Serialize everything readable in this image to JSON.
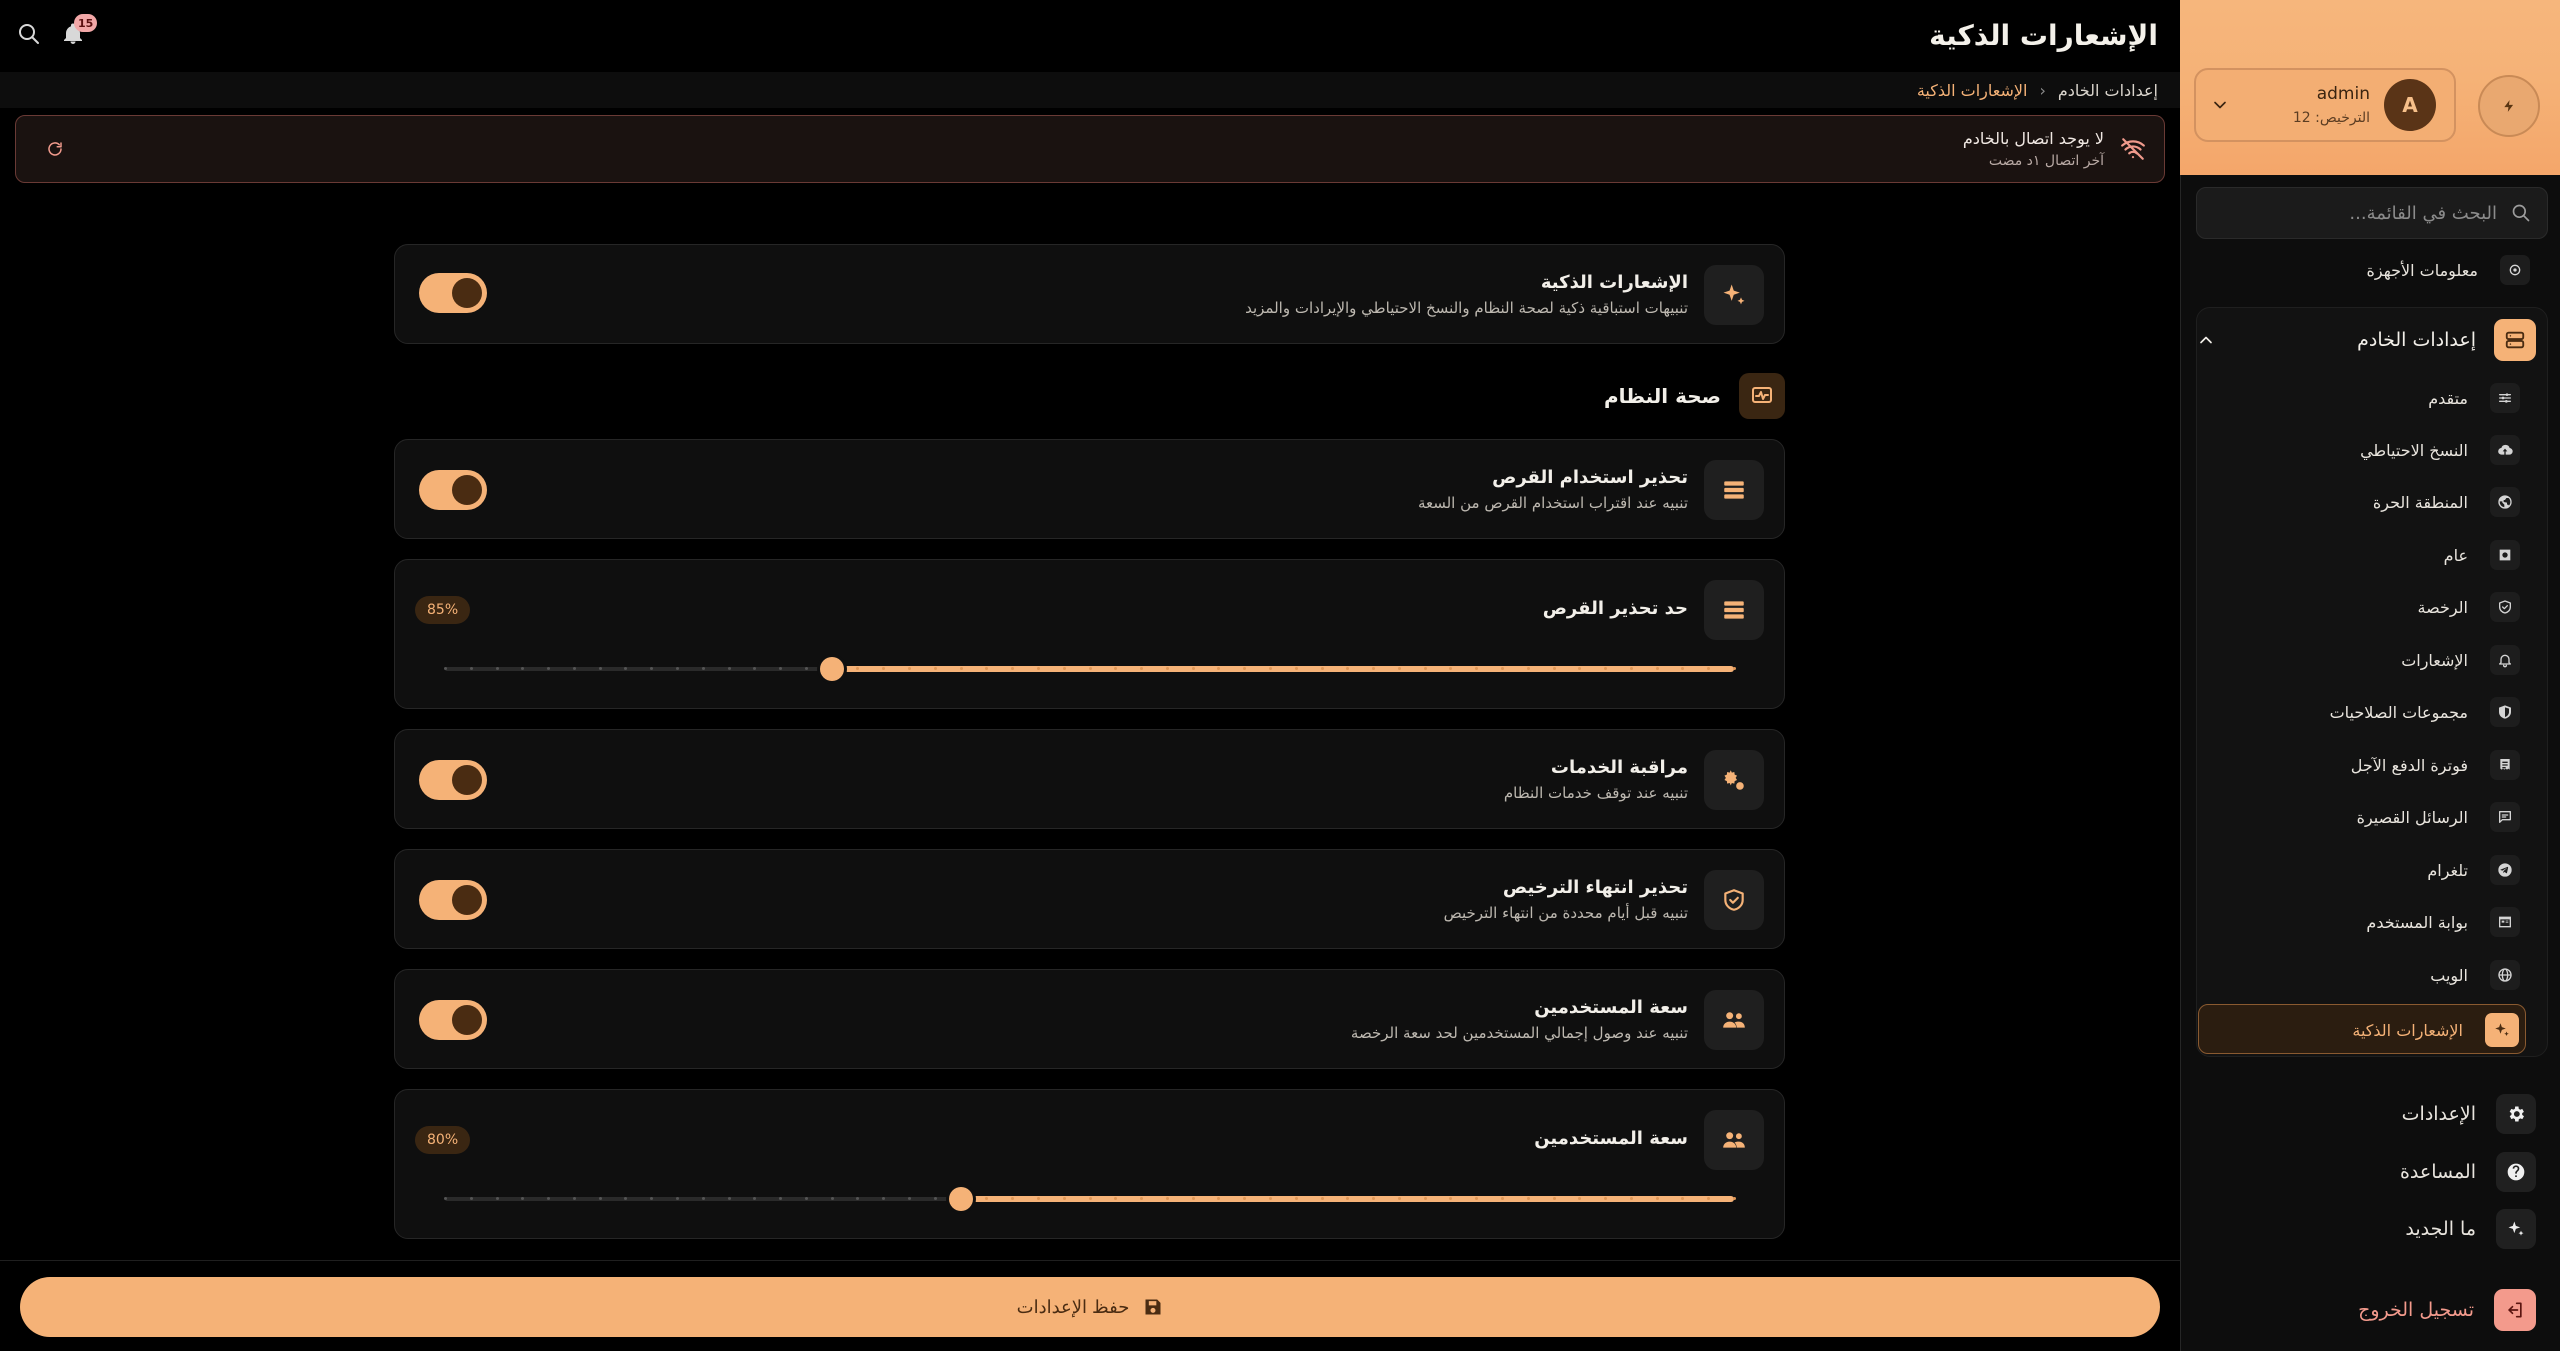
{
  "header": {
    "title": "الإشعارات الذكية",
    "notifications_count": "15"
  },
  "breadcrumb": {
    "parent": "إعدادات الخادم",
    "sep": "‹",
    "current": "الإشعارات الذكية"
  },
  "alert": {
    "title": "لا يوجد اتصال بالخادم",
    "subtitle": "آخر اتصال ١د مضت"
  },
  "sidebar": {
    "user": {
      "initial": "A",
      "name": "admin",
      "license": "الترخيص: 12"
    },
    "search_placeholder": "البحث في القائمة...",
    "top_item": "معلومات الأجهزة",
    "group": {
      "label": "إعدادات الخادم",
      "items": [
        {
          "label": "متقدم",
          "icon": "sliders-icon"
        },
        {
          "label": "النسخ الاحتياطي",
          "icon": "cloud-upload-icon"
        },
        {
          "label": "المنطقة الحرة",
          "icon": "globe-icon"
        },
        {
          "label": "عام",
          "icon": "square-dot-icon"
        },
        {
          "label": "الرخصة",
          "icon": "shield-check-icon"
        },
        {
          "label": "الإشعارات",
          "icon": "bell-icon"
        },
        {
          "label": "مجموعات الصلاحيات",
          "icon": "shield-half-icon"
        },
        {
          "label": "فوترة الدفع الآجل",
          "icon": "receipt-icon"
        },
        {
          "label": "الرسائل القصيرة",
          "icon": "message-icon"
        },
        {
          "label": "تلغرام",
          "icon": "telegram-icon"
        },
        {
          "label": "بوابة المستخدم",
          "icon": "portal-icon"
        },
        {
          "label": "الويب",
          "icon": "web-icon"
        }
      ],
      "active": "الإشعارات الذكية"
    },
    "bottom": {
      "settings": "الإعدادات",
      "help": "المساعدة",
      "whats_new": "ما الجديد",
      "logout": "تسجيل الخروج"
    }
  },
  "main": {
    "master": {
      "title": "الإشعارات الذكية",
      "desc": "تنبيهات استباقية ذكية لصحة النظام والنسخ الاحتياطي والإيرادات والمزيد",
      "enabled": true
    },
    "section_title": "صحة النظام",
    "disk_warning": {
      "title": "تحذير استخدام القرص",
      "desc": "تنبيه عند اقتراب استخدام القرص من السعة",
      "enabled": true
    },
    "disk_threshold": {
      "title": "حد تحذير القرص",
      "value_label": "85%",
      "value": 85,
      "min": 50,
      "max": 100
    },
    "services": {
      "title": "مراقبة الخدمات",
      "desc": "تنبيه عند توقف خدمات النظام",
      "enabled": true
    },
    "license_expiry": {
      "title": "تحذير انتهاء الترخيص",
      "desc": "تنبيه قبل أيام محددة من انتهاء الترخيص",
      "enabled": true
    },
    "user_capacity": {
      "title": "سعة المستخدمين",
      "desc": "تنبيه عند وصول إجمالي المستخدمين لحد سعة الرخصة",
      "enabled": true
    },
    "user_threshold": {
      "title": "سعة المستخدمين",
      "value_label": "80%",
      "value": 80,
      "min": 50,
      "max": 100
    }
  },
  "footer": {
    "save_label": "حفظ الإعدادات"
  },
  "colors": {
    "accent": "#f5b277",
    "background": "#000000",
    "card": "#0f0f0f",
    "danger": "#f09a8c"
  }
}
